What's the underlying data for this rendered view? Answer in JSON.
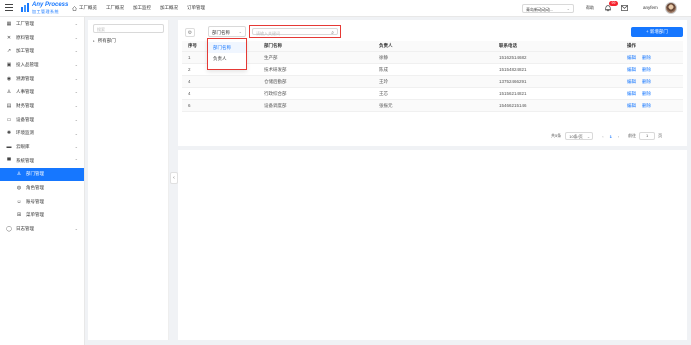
{
  "header": {
    "logo_title": "Any Process",
    "logo_subtitle": "加工管理系统",
    "nav": [
      "工厂概览",
      "工厂概况",
      "加工监控",
      "加工概况",
      "订单管理"
    ],
    "factory_select": "青岛新动动动...",
    "help": "帮助",
    "badge_count": "99",
    "username": "anyfem"
  },
  "sidebar": {
    "items": [
      {
        "label": "工厂管理",
        "icon": "grid-icon",
        "arrow": "chevron-down"
      },
      {
        "label": "原料管理",
        "icon": "cross-icon",
        "arrow": "chevron-down"
      },
      {
        "label": "加工管理",
        "icon": "tool-icon",
        "arrow": "chevron-down"
      },
      {
        "label": "投入品管理",
        "icon": "box-icon",
        "arrow": "chevron-down"
      },
      {
        "label": "溯源管理",
        "icon": "signal-icon",
        "arrow": "chevron-down"
      },
      {
        "label": "人事管理",
        "icon": "person-icon",
        "arrow": "chevron-down"
      },
      {
        "label": "财务管理",
        "icon": "ledger-icon",
        "arrow": "chevron-down"
      },
      {
        "label": "设备管理",
        "icon": "device-icon",
        "arrow": "chevron-down"
      },
      {
        "label": "环境监测",
        "icon": "sun-icon",
        "arrow": "chevron-down"
      },
      {
        "label": "云眼库",
        "icon": "cloud-icon",
        "arrow": "chevron-down"
      },
      {
        "label": "系统管理",
        "icon": "monitor-icon",
        "arrow": "chevron-up"
      }
    ],
    "sub_items": [
      {
        "label": "部门管理",
        "icon": "org-icon",
        "active": true
      },
      {
        "label": "角色管理",
        "icon": "role-icon",
        "active": false
      },
      {
        "label": "账号管理",
        "icon": "account-icon",
        "active": false
      },
      {
        "label": "菜单管理",
        "icon": "menu-icon",
        "active": false
      }
    ],
    "log_item": {
      "label": "日志管理",
      "icon": "log-icon"
    }
  },
  "tree": {
    "search_placeholder": "搜索",
    "root_label": "所有部门"
  },
  "toolbar": {
    "field_select": "部门名称",
    "search_placeholder": "请输入关键词",
    "add_label": "+ 新增部门"
  },
  "dropdown": {
    "options": [
      "部门名称",
      "负责人"
    ]
  },
  "table": {
    "columns": [
      "序号",
      "部门名称",
      "负责人",
      "联系电话",
      "操作"
    ],
    "rows": [
      {
        "no": "1",
        "dept": "生产部",
        "leader": "徐静",
        "phone": "15162514682"
      },
      {
        "no": "2",
        "dept": "技术研发部",
        "leader": "陈成",
        "phone": "15154824821"
      },
      {
        "no": "4",
        "dept": "仓储后勤部",
        "leader": "王玲",
        "phone": "13752466291"
      },
      {
        "no": "4",
        "dept": "行政综合部",
        "leader": "王芯",
        "phone": "15156214821"
      },
      {
        "no": "6",
        "dept": "设备调度部",
        "leader": "张振元",
        "phone": "15466215146"
      }
    ],
    "edit_label": "编辑",
    "delete_label": "删除"
  },
  "pager": {
    "total": "共5条",
    "page_size": "10条/页",
    "current_page": "1",
    "goto_label": "前往",
    "goto_value": "1",
    "page_suffix": "页"
  },
  "colors": {
    "accent": "#1677ff",
    "highlight": "#e53935"
  }
}
